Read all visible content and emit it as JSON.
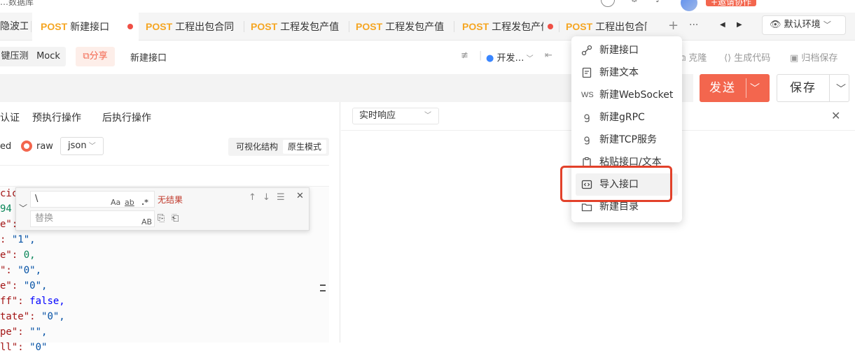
{
  "topbar": {
    "breadcrumb": "…数据库",
    "invite_label": "+邀请协作"
  },
  "tabs": [
    {
      "method": "",
      "title": "隐波工",
      "dot": false
    },
    {
      "method": "POST",
      "title": "新建接口",
      "dot": true,
      "active": true
    },
    {
      "method": "POST",
      "title": "工程出包合同",
      "dot": false
    },
    {
      "method": "POST",
      "title": "工程发包产值",
      "dot": false
    },
    {
      "method": "POST",
      "title": "工程发包产值",
      "dot": false
    },
    {
      "method": "POST",
      "title": "工程发包产值",
      "dot": true
    },
    {
      "method": "POST",
      "title": "工程出包合同",
      "dot": false
    }
  ],
  "tabbar": {
    "add_label": "+",
    "more_label": "···",
    "prev": "◀",
    "next": "▶",
    "env_label": "默认环境"
  },
  "toolbar": {
    "stress_label": "键压测",
    "mock_label": "Mock",
    "share_label": "分享",
    "api_name": "新建接口",
    "status_label": "开发…",
    "clone_label": "克隆",
    "gencode_label": "生成代码",
    "archive_label": "归档保存"
  },
  "request": {
    "send_label": "发送",
    "save_label": "保存"
  },
  "left_tabs": [
    "认证",
    "预执行操作",
    "后执行操作"
  ],
  "body": {
    "encoding_partial": "ed",
    "raw_label": "raw",
    "format": "json",
    "mode_visual": "可视化结构",
    "mode_raw": "原生模式"
  },
  "code_lines": [
    {
      "k": "cic",
      "v": "",
      "vt": ""
    },
    {
      "k": "",
      "v": "94",
      "vt": "n"
    },
    {
      "k": "e\":",
      "v": "",
      "vt": ""
    },
    {
      "k": ": ",
      "v": "\"1\",",
      "vt": "s"
    },
    {
      "k": "e\": ",
      "v": "0,",
      "vt": "n"
    },
    {
      "k": "\": ",
      "v": "\"0\",",
      "vt": "s"
    },
    {
      "k": "e\": ",
      "v": "\"0\",",
      "vt": "s"
    },
    {
      "k": "ff\": ",
      "v": "false,",
      "vt": "b"
    },
    {
      "k": "tate\": ",
      "v": "\"0\",",
      "vt": "s"
    },
    {
      "k": "pe\": ",
      "v": "\"\",",
      "vt": "s"
    },
    {
      "k": "ll\": ",
      "v": "\"0\"",
      "vt": "s"
    }
  ],
  "find": {
    "search_value": "\\",
    "replace_placeholder": "替换",
    "match_case": "Aa",
    "whole_word": "ab",
    "regex": ".*",
    "preserve_case": "AB",
    "no_result": "无结果"
  },
  "response": {
    "mode_label": "实时响应"
  },
  "menu": {
    "items": [
      {
        "label": "新建接口",
        "icon": "link-icon"
      },
      {
        "label": "新建文本",
        "icon": "document-icon"
      },
      {
        "label": "新建WebSocket",
        "icon": "websocket-icon",
        "icon_text": "WS"
      },
      {
        "label": "新建gRPC",
        "icon": "grpc-icon"
      },
      {
        "label": "新建TCP服务",
        "icon": "tcp-icon"
      },
      {
        "label": "粘贴接口/文本",
        "icon": "paste-icon"
      },
      {
        "label": "导入接口",
        "icon": "import-icon",
        "highlighted": true
      },
      {
        "label": "新建目录",
        "icon": "folder-icon"
      }
    ]
  },
  "colors": {
    "accent": "#f3664e",
    "method": "#f5a623",
    "dirty_dot": "#ef4f45",
    "highlight_box": "#e2412a"
  }
}
